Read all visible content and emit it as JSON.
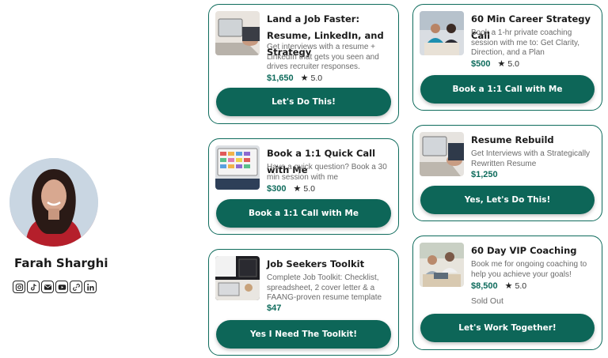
{
  "profile": {
    "name": "Farah Sharghi",
    "socials": [
      "instagram-icon",
      "tiktok-icon",
      "email-icon",
      "youtube-icon",
      "link-icon",
      "linkedin-icon"
    ]
  },
  "cards": [
    {
      "title": "Land a Job Faster: Resume, LinkedIn, and Strategy",
      "description": "Get interviews with a resume + LinkedIn that gets you seen and drives recruiter responses.",
      "price": "$1,650",
      "rating": "5.0",
      "button": "Let's Do This!"
    },
    {
      "title": "60 Min Career Strategy Call",
      "description": "Book a 1-hr private coaching session with me to: Get Clarity, Direction, and a Plan",
      "price": "$500",
      "rating": "5.0",
      "button": "Book a 1:1 Call with Me"
    },
    {
      "title": "Book a 1:1 Quick Call with Me",
      "description": "Have a quick question? Book a 30 min session with me",
      "price": "$300",
      "rating": "5.0",
      "button": "Book a 1:1 Call with Me"
    },
    {
      "title": "Resume Rebuild",
      "description": "Get Interviews with a Strategically Rewritten Resume",
      "price": "$1,250",
      "button": "Yes, Let's Do This!"
    },
    {
      "title": "Job Seekers Toolkit",
      "description": "Complete Job Toolkit: Checklist, spreadsheet, 2 cover letter & a FAANG-proven resume template",
      "price": "$47",
      "button": "Yes I Need The Toolkit!"
    },
    {
      "title": "60 Day VIP Coaching",
      "description": "Book me for ongoing coaching to help you achieve your goals!",
      "price": "$8,500",
      "rating": "5.0",
      "status": "Sold Out",
      "button": "Let's Work Together!"
    }
  ],
  "colors": {
    "accent": "#0d6658",
    "border": "#0e6b5c",
    "price": "#0e6b5c"
  }
}
